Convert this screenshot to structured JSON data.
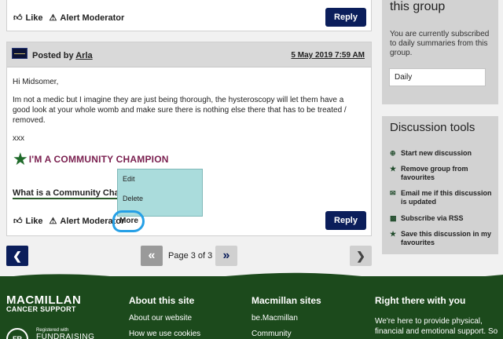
{
  "top_post": {
    "like_label": "Like",
    "alert_label": "Alert Moderator",
    "reply_label": "Reply"
  },
  "post": {
    "posted_by_prefix": "Posted by",
    "author": "Arla",
    "date": "5 May 2019 7:59 AM",
    "greeting": "Hi Midsomer,",
    "body": "Im not a medic but I imagine they are just being thorough, the hysteroscopy will let them have a good look at your whole womb and make sure there is nothing else there that has to be treated / removed.",
    "signoff": "xxx",
    "signature_text": "I'M A COMMUNITY CHAMPION",
    "what_link": "What is a Community Champion?",
    "like_label": "Like",
    "alert_label": "Alert Moderator",
    "more_label": "More",
    "reply_label": "Reply"
  },
  "more_menu": {
    "items": [
      "Edit",
      "Delete"
    ]
  },
  "pagination": {
    "page_text": "Page 3 of 3"
  },
  "sidebar": {
    "group_title": "this group",
    "subscribed_text": "You are currently subscribed to daily summaries from this group.",
    "frequency_value": "Daily",
    "tools_title": "Discussion tools",
    "tools": [
      {
        "icon": "plus-circle-icon",
        "label": "Start new discussion"
      },
      {
        "icon": "star-icon",
        "label": "Remove group from favourites"
      },
      {
        "icon": "envelope-icon",
        "label": "Email me if this discussion is updated"
      },
      {
        "icon": "rss-icon",
        "label": "Subscribe via RSS"
      },
      {
        "icon": "star-icon",
        "label": "Save this discussion in my favourites"
      }
    ]
  },
  "footer": {
    "logo_line1": "MACMILLAN",
    "logo_line2": "CANCER SUPPORT",
    "fr_badge": "FR",
    "fr_registered": "Registered with",
    "fr_name": "FUNDRAISING",
    "col1_title": "About this site",
    "col1_links": [
      "About our website",
      "How we use cookies"
    ],
    "col2_title": "Macmillan sites",
    "col2_links": [
      "be.Macmillan",
      "Community"
    ],
    "col3_title": "Right there with you",
    "col3_text": "We're here to provide physical, financial and emotional support. So"
  }
}
